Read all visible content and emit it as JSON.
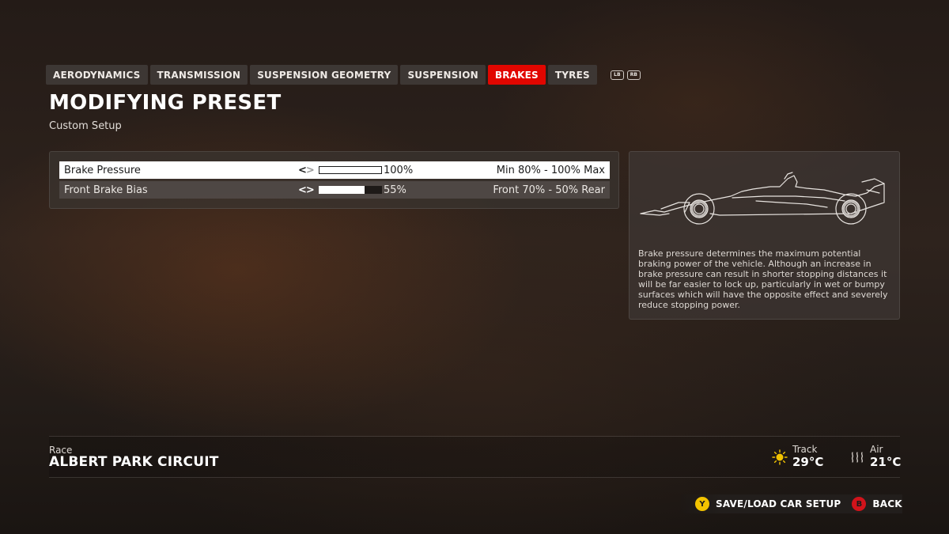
{
  "tabs": [
    {
      "label": "AERODYNAMICS",
      "active": false
    },
    {
      "label": "TRANSMISSION",
      "active": false
    },
    {
      "label": "SUSPENSION GEOMETRY",
      "active": false
    },
    {
      "label": "SUSPENSION",
      "active": false
    },
    {
      "label": "BRAKES",
      "active": true
    },
    {
      "label": "TYRES",
      "active": false
    }
  ],
  "bumpers": {
    "left": "LB",
    "right": "RB"
  },
  "header": {
    "title": "MODIFYING PRESET",
    "subtitle": "Custom Setup"
  },
  "settings": [
    {
      "label": "Brake Pressure",
      "value": "100%",
      "fraction": 1.0,
      "range": "Min 80% - 100% Max",
      "selected": true
    },
    {
      "label": "Front Brake Bias",
      "value": "55%",
      "fraction": 0.72,
      "range": "Front 70% - 50% Rear",
      "selected": false
    }
  ],
  "info": {
    "description": "Brake pressure determines the maximum potential braking power of the vehicle. Although an increase in brake pressure can result in shorter stopping distances it will be far easier to lock up, particularly in wet or bumpy surfaces which will have the opposite effect and severely reduce stopping power."
  },
  "race": {
    "label": "Race",
    "circuit": "ALBERT PARK CIRCUIT"
  },
  "weather": {
    "track": {
      "label": "Track",
      "value": "29°C",
      "icon": "sun-icon"
    },
    "air": {
      "label": "Air",
      "value": "21°C",
      "icon": "heat-waves-icon"
    }
  },
  "footer": {
    "save": {
      "glyph": "Y",
      "label": "SAVE/LOAD CAR SETUP"
    },
    "back": {
      "glyph": "B",
      "label": "BACK"
    }
  },
  "colors": {
    "accent": "#e10600",
    "glyph_y": "#f2c300",
    "glyph_b": "#d1131b"
  }
}
